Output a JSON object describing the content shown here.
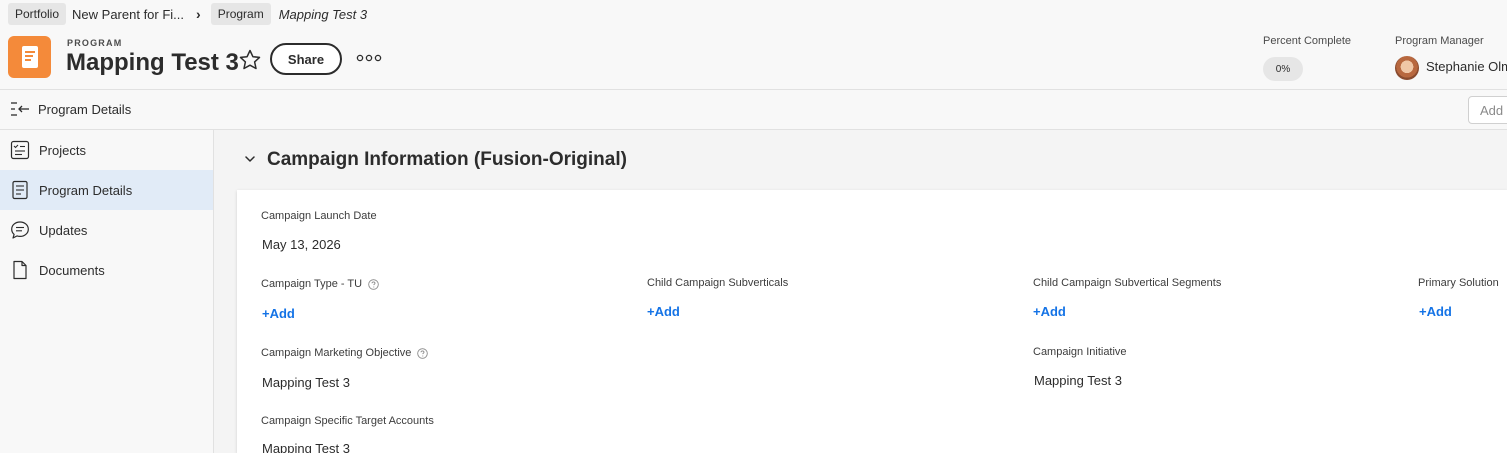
{
  "breadcrumb": {
    "portfolio_tag": "Portfolio",
    "portfolio_name": "New Parent for Fi...",
    "program_tag": "Program",
    "program_name": "Mapping Test 3"
  },
  "header": {
    "object_type": "PROGRAM",
    "title": "Mapping Test 3",
    "share_label": "Share",
    "percent_complete_label": "Percent Complete",
    "percent_complete_value": "0%",
    "program_manager_label": "Program Manager",
    "program_manager_name": "Stephanie Olm"
  },
  "subbar": {
    "title": "Program Details",
    "add_label": "Add"
  },
  "sidebar": {
    "items": [
      {
        "label": "Projects",
        "icon": "projects-icon",
        "active": false
      },
      {
        "label": "Program Details",
        "icon": "details-icon",
        "active": true
      },
      {
        "label": "Updates",
        "icon": "updates-icon",
        "active": false
      },
      {
        "label": "Documents",
        "icon": "document-icon",
        "active": false
      }
    ]
  },
  "section": {
    "title": "Campaign Information (Fusion-Original)"
  },
  "fields": {
    "launch_date": {
      "label": "Campaign Launch Date",
      "value": "May 13, 2026"
    },
    "campaign_type": {
      "label": "Campaign Type - TU",
      "add": "+Add"
    },
    "child_subverticals": {
      "label": "Child Campaign Subverticals",
      "add": "+Add"
    },
    "child_subvertical_segments": {
      "label": "Child Campaign Subvertical Segments",
      "add": "+Add"
    },
    "primary_solution": {
      "label": "Primary Solution",
      "add": "+Add"
    },
    "marketing_objective": {
      "label": "Campaign Marketing Objective",
      "value": "Mapping Test 3"
    },
    "initiative": {
      "label": "Campaign Initiative",
      "value": "Mapping Test 3"
    },
    "target_accounts": {
      "label": "Campaign Specific Target Accounts",
      "value": "Mapping Test 3"
    }
  },
  "colors": {
    "accent_blue": "#1473e6",
    "app_orange": "#f48a3a",
    "active_nav": "#e1ebf7"
  }
}
